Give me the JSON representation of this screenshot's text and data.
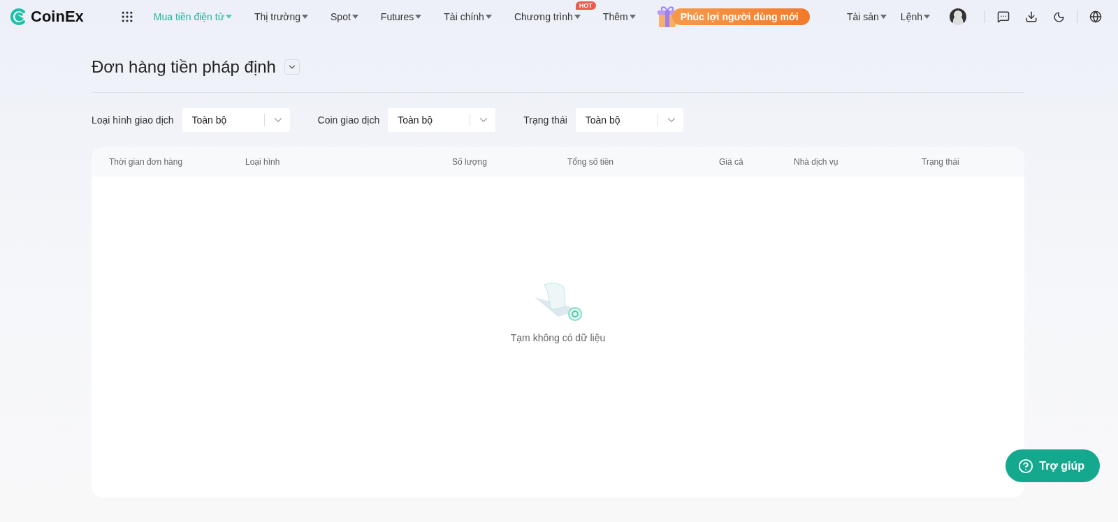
{
  "logo": {
    "text": "CoinEx"
  },
  "nav": [
    {
      "label": "Mua tiền điện tử",
      "selected": true
    },
    {
      "label": "Thị trường",
      "selected": false
    },
    {
      "label": "Spot",
      "selected": false
    },
    {
      "label": "Futures",
      "selected": false
    },
    {
      "label": "Tài chính",
      "selected": false
    },
    {
      "label": "Chương trình",
      "selected": false,
      "badge": "HOT"
    },
    {
      "label": "Thêm",
      "selected": false
    }
  ],
  "promo": {
    "label": "Phúc lợi người dùng mới"
  },
  "nav_right": [
    {
      "label": "Tài sản"
    },
    {
      "label": "Lệnh"
    }
  ],
  "page": {
    "title": "Đơn hàng tiền pháp định"
  },
  "filters": [
    {
      "label": "Loại hình giao dịch",
      "value": "Toàn bộ"
    },
    {
      "label": "Coin giao dịch",
      "value": "Toàn bộ"
    },
    {
      "label": "Trạng thái",
      "value": "Toàn bộ"
    }
  ],
  "table": {
    "columns": [
      "Thời gian đơn hàng",
      "Loại hình",
      "Số lượng",
      "Tổng số tiền",
      "Giá cả",
      "Nhà dịch vụ",
      "Trạng thái"
    ],
    "empty_text": "Tạm không có dữ liệu"
  },
  "help": {
    "label": "Trợ giúp"
  }
}
